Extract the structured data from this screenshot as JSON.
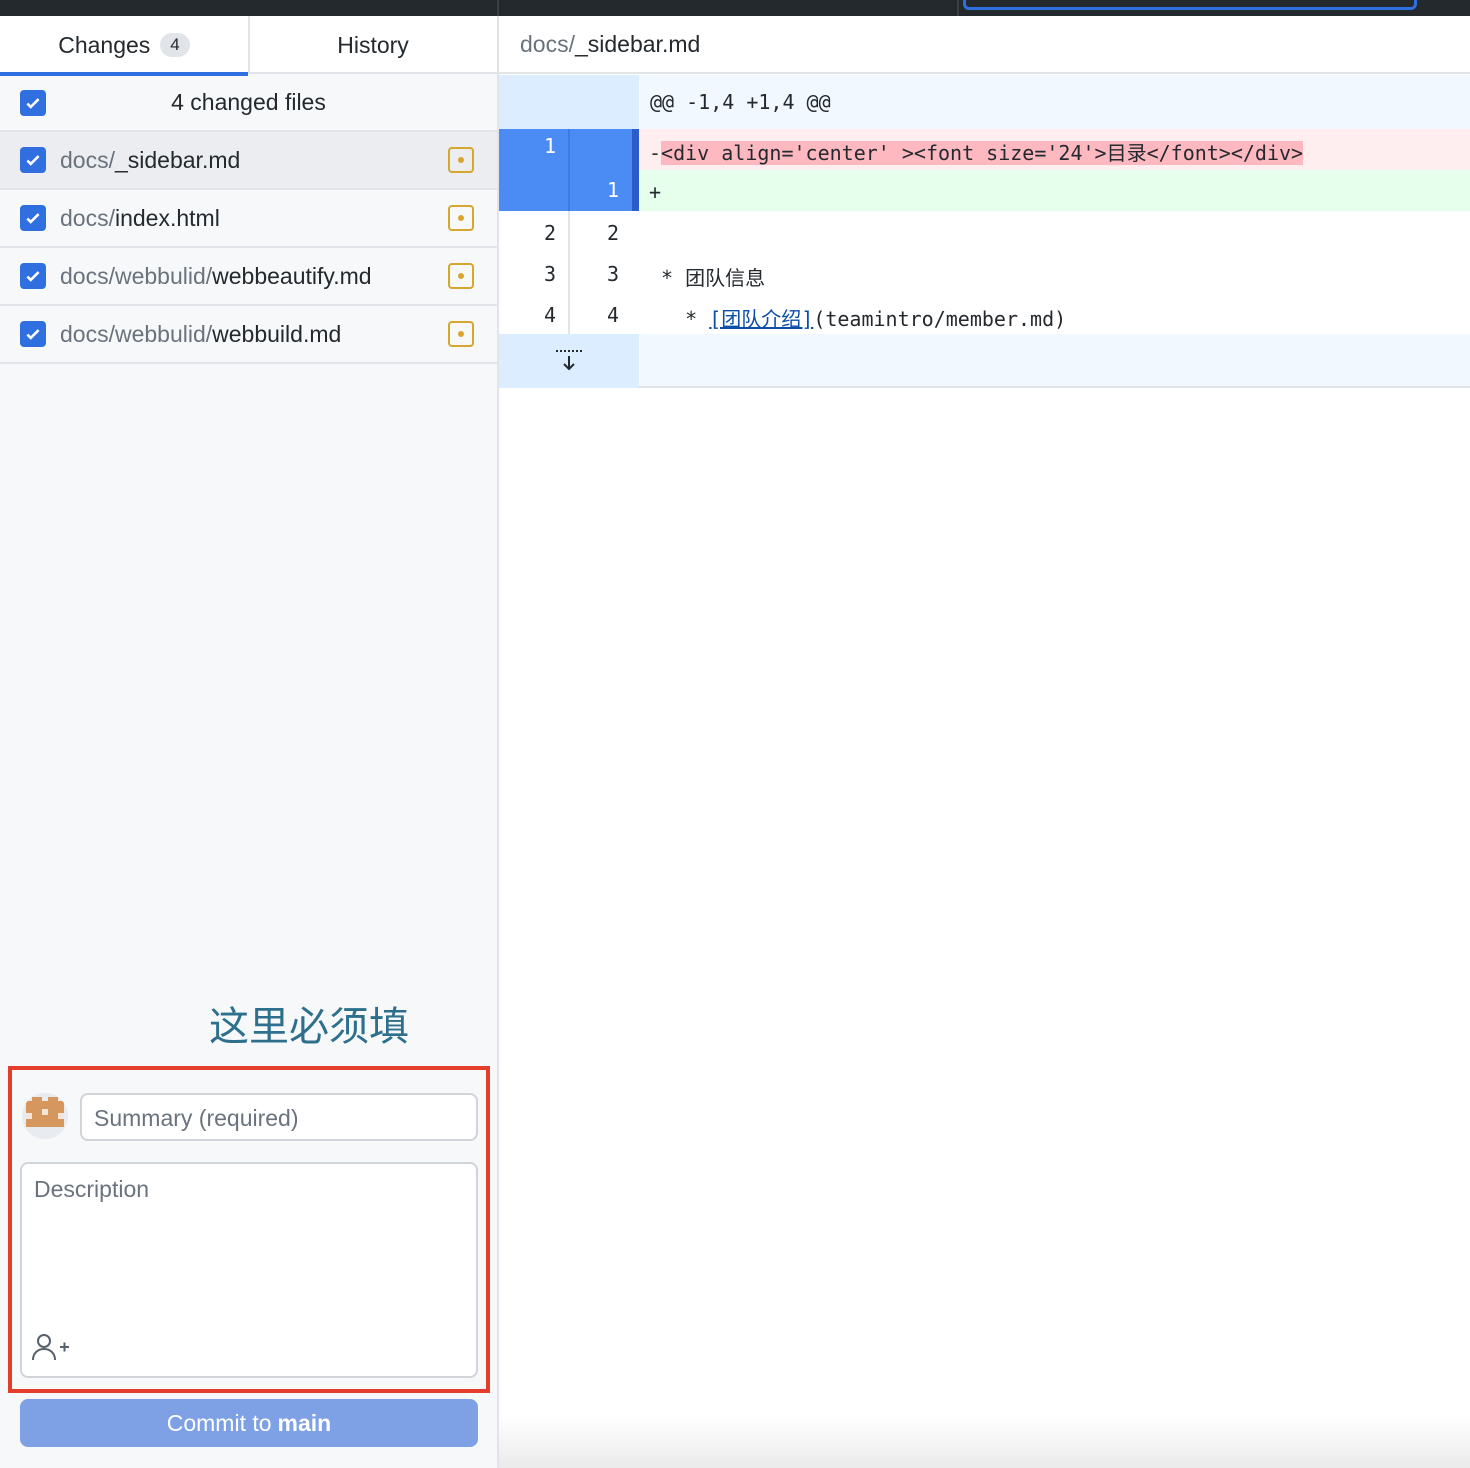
{
  "left_tabs": {
    "changes_label": "Changes",
    "changes_count": "4",
    "history_label": "History"
  },
  "changes": {
    "header_label": "4 changed files",
    "files": [
      {
        "dir": "docs/",
        "name": "_sidebar.md"
      },
      {
        "dir": "docs/",
        "name": "index.html"
      },
      {
        "dir": "docs/webbulid/",
        "name": "webbeautify.md"
      },
      {
        "dir": "docs/webbulid/",
        "name": "webbuild.md"
      }
    ]
  },
  "annotation": {
    "note": "这里必须填",
    "highlight_color": "#e23e2b"
  },
  "commit": {
    "summary_placeholder": "Summary (required)",
    "description_placeholder": "Description",
    "button_prefix": "Commit to",
    "button_branch": "main"
  },
  "diff": {
    "path_dir": "docs/",
    "path_name": "_sidebar.md",
    "hunk_header": "@@ -1,4 +1,4 @@",
    "del_line": {
      "old": "1",
      "new": "",
      "prefix": "-",
      "text": "<div align='center' ><font size='24'>目录</font></div>"
    },
    "add_line": {
      "old": "",
      "new": "1",
      "text": "+"
    },
    "ctx_lines": [
      {
        "old": "2",
        "new": "2",
        "text": ""
      },
      {
        "old": "3",
        "new": "3",
        "text": " * 团队信息"
      },
      {
        "old": "4",
        "new": "4",
        "text_pre": "   * ",
        "link": "[团队介绍]",
        "text_post": "(teamintro/member.md)"
      }
    ]
  },
  "colors": {
    "accent": "#2f6fe0",
    "modified": "#d6a72c"
  }
}
